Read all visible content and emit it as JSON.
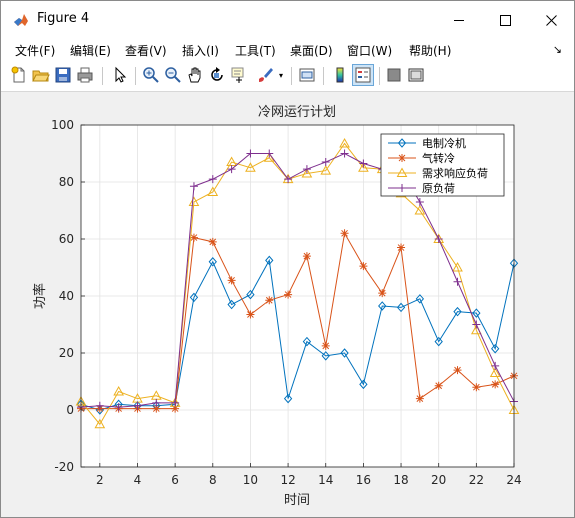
{
  "window": {
    "title": "Figure 4",
    "controls": {
      "minimize": "—",
      "maximize": "☐",
      "close": "✕"
    }
  },
  "menus": [
    "文件(F)",
    "编辑(E)",
    "查看(V)",
    "插入(I)",
    "工具(T)",
    "桌面(D)",
    "窗口(W)",
    "帮助(H)"
  ],
  "menu_overflow": "↘",
  "toolbar": [
    "new-figure-icon",
    "open-icon",
    "save-icon",
    "print-icon",
    "pointer-icon",
    "zoom-in-icon",
    "zoom-out-icon",
    "pan-icon",
    "rotate-icon",
    "data-cursor-icon",
    "brush-icon",
    "link-icon",
    "colorbar-icon",
    "legend-icon",
    "hide-plot-tools-icon",
    "show-plot-tools-icon"
  ],
  "colors": {
    "series1": "#0072BD",
    "series2": "#D95319",
    "series3": "#EDB120",
    "series4": "#7E2F8E"
  },
  "chart_data": {
    "type": "line",
    "title": "冷网运行计划",
    "xlabel": "时间",
    "ylabel": "功率",
    "xlim": [
      1,
      24
    ],
    "ylim": [
      -20,
      100
    ],
    "xticks": [
      2,
      4,
      6,
      8,
      10,
      12,
      14,
      16,
      18,
      20,
      22,
      24
    ],
    "yticks": [
      -20,
      0,
      20,
      40,
      60,
      80,
      100
    ],
    "grid": true,
    "legend_position": "top-right",
    "x": [
      1,
      2,
      3,
      4,
      5,
      6,
      7,
      8,
      9,
      10,
      11,
      12,
      13,
      14,
      15,
      16,
      17,
      18,
      19,
      20,
      21,
      22,
      23,
      24
    ],
    "series": [
      {
        "name": "电制冷机",
        "marker": "diamond",
        "values": [
          2,
          0,
          2,
          1.5,
          1.5,
          2,
          39.5,
          52,
          37,
          40.5,
          52.5,
          4,
          24,
          19,
          20,
          9,
          36.5,
          36,
          39,
          24,
          34.5,
          34,
          21.5,
          51.5
        ]
      },
      {
        "name": "气转冷",
        "marker": "star",
        "values": [
          0.5,
          0.5,
          0.5,
          0.5,
          0.5,
          0.5,
          60.5,
          59,
          45.5,
          33.5,
          38.5,
          40.5,
          54,
          22.5,
          62,
          50.5,
          41,
          57,
          4,
          8.5,
          14,
          8,
          9,
          12
        ]
      },
      {
        "name": "需求响应负荷",
        "marker": "triangle",
        "values": [
          3,
          -5,
          6.5,
          4,
          5,
          2.5,
          73,
          76.5,
          87,
          85,
          88.5,
          81,
          83,
          84,
          93.5,
          85,
          84.5,
          76,
          70,
          60,
          50,
          28,
          13,
          0
        ]
      },
      {
        "name": "原负荷",
        "marker": "plus",
        "values": [
          1,
          1.5,
          1,
          1.5,
          2.5,
          2.5,
          78.5,
          81,
          84.5,
          90,
          90,
          81,
          84.5,
          87,
          90,
          86.5,
          84.5,
          84,
          73,
          60,
          45,
          30,
          15.5,
          3
        ]
      }
    ]
  }
}
